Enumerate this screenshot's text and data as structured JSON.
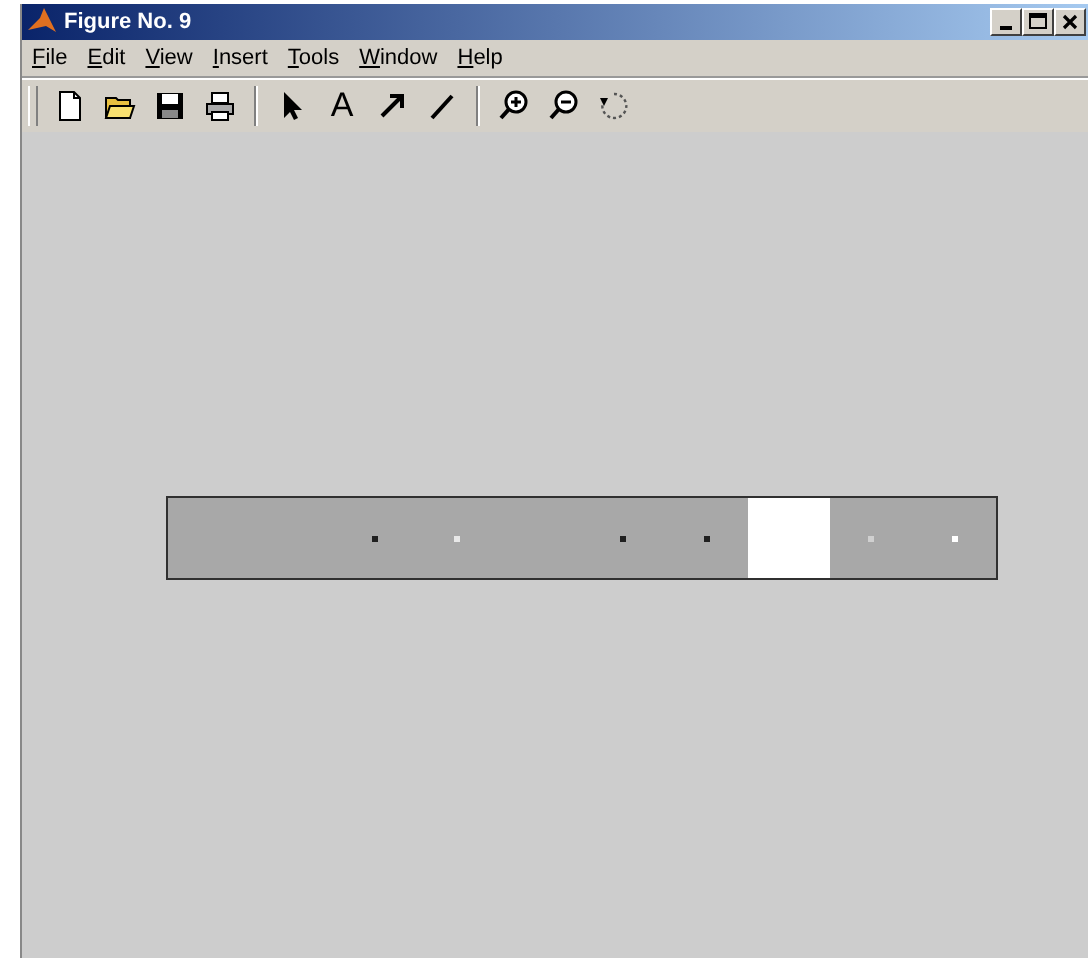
{
  "window": {
    "title": "Figure No. 9"
  },
  "menu": [
    {
      "label": "File"
    },
    {
      "label": "Edit"
    },
    {
      "label": "View"
    },
    {
      "label": "Insert"
    },
    {
      "label": "Tools"
    },
    {
      "label": "Window"
    },
    {
      "label": "Help"
    }
  ],
  "toolbar": [
    {
      "kind": "grip"
    },
    {
      "kind": "new"
    },
    {
      "kind": "open"
    },
    {
      "kind": "save"
    },
    {
      "kind": "print"
    },
    {
      "kind": "separator"
    },
    {
      "kind": "pointer"
    },
    {
      "kind": "text",
      "label": "A"
    },
    {
      "kind": "arrow"
    },
    {
      "kind": "line"
    },
    {
      "kind": "separator"
    },
    {
      "kind": "zoomin"
    },
    {
      "kind": "zoomout"
    },
    {
      "kind": "rotate"
    }
  ],
  "figure": {
    "cells": [
      {
        "color": "#a8a8a8"
      },
      {
        "color": "#a8a8a8"
      },
      {
        "color": "#a8a8a8",
        "dot": {
          "color": "#202020"
        }
      },
      {
        "color": "#a8a8a8",
        "dot": {
          "color": "#e8e8e8"
        }
      },
      {
        "color": "#a8a8a8"
      },
      {
        "color": "#a8a8a8",
        "dot": {
          "color": "#202020"
        }
      },
      {
        "color": "#a8a8a8",
        "dot": {
          "color": "#202020"
        }
      },
      {
        "color": "#ffffff"
      },
      {
        "color": "#a8a8a8",
        "dot": {
          "color": "#d0d0d0"
        }
      },
      {
        "color": "#a8a8a8",
        "dot": {
          "color": "#ffffff"
        }
      }
    ]
  }
}
